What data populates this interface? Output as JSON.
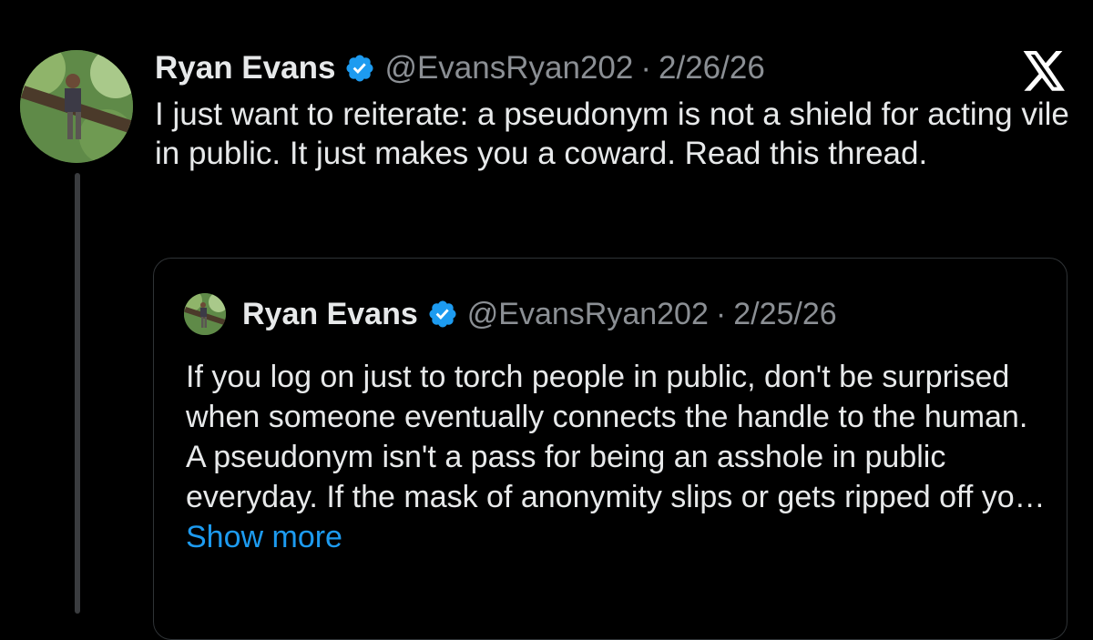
{
  "post": {
    "author_name": "Ryan Evans",
    "handle": "@EvansRyan202",
    "separator": "·",
    "date": "2/26/26",
    "text": "I just want to reiterate: a pseudonym is not a shield for acting vile in public. It just makes you a coward. Read this thread.",
    "verified_icon": "verified-badge-icon",
    "logo_icon": "x-logo-icon"
  },
  "quoted_post": {
    "author_name": "Ryan Evans",
    "handle": "@EvansRyan202",
    "separator": "·",
    "date": "2/25/26",
    "text": "If you log on just to torch people in public, don't be surprised when someone eventually connects the handle to the human. A pseudonym isn't a pass for being an asshole in public everyday. If the mask of anonymity slips or gets ripped off yo…",
    "show_more_label": "Show more"
  },
  "colors": {
    "background": "#000000",
    "text": "#e7e9ea",
    "muted": "#8b8f94",
    "link": "#1d9bf0",
    "verified": "#1d9bf0"
  }
}
